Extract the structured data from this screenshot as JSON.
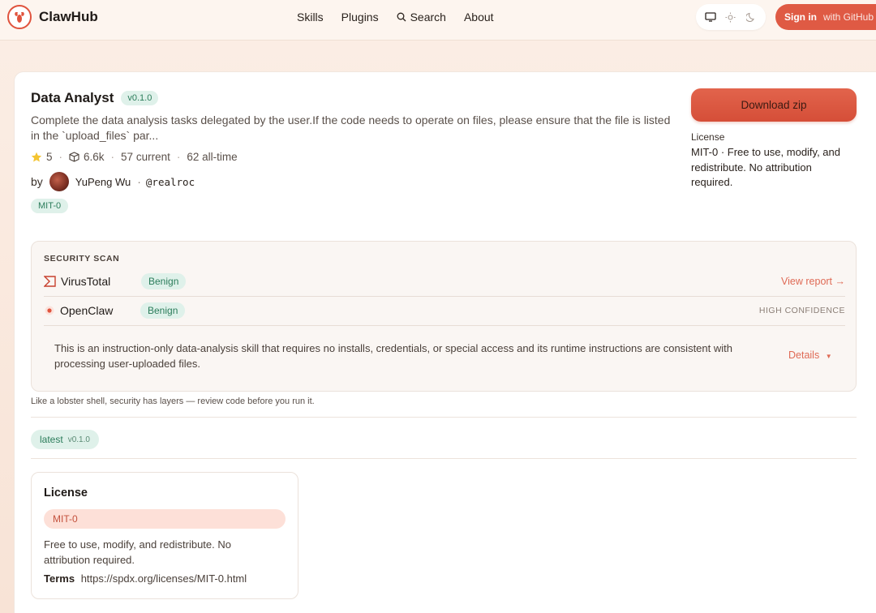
{
  "header": {
    "brand": "ClawHub",
    "nav": [
      "Skills",
      "Plugins",
      "Search",
      "About"
    ],
    "signin_label": "Sign in",
    "signin_suffix": "with GitHub"
  },
  "skill": {
    "title": "Data Analyst",
    "version": "v0.1.0",
    "description": "Complete the data analysis tasks delegated by the user.If the code needs to operate on files, please ensure that the file is listed in the `upload_files` par...",
    "stars": "5",
    "downloads": "6.6k",
    "current": "57 current",
    "all_time": "62 all-time",
    "by_label": "by",
    "author": "YuPeng Wu",
    "separator": "·",
    "handle": "@realroc",
    "license_pill": "MIT-0"
  },
  "sidebar": {
    "download_label": "Download zip",
    "license_label": "License",
    "license_text": "MIT-0 · Free to use, modify, and redistribute. No attribution required."
  },
  "security": {
    "heading": "SECURITY SCAN",
    "rows": [
      {
        "name": "VirusTotal",
        "status": "Benign",
        "action": "View report →"
      },
      {
        "name": "OpenClaw",
        "status": "Benign",
        "meta": "HIGH CONFIDENCE"
      }
    ],
    "summary": "This is an instruction-only data-analysis skill that requires no installs, credentials, or special access and its runtime instructions are consistent with processing user-uploaded files.",
    "details_label": "Details",
    "note": "Like a lobster shell, security has layers — review code before you run it."
  },
  "versions": {
    "latest_label": "latest",
    "latest_version": "v0.1.0"
  },
  "license_card": {
    "title": "License",
    "tag": "MIT-0",
    "description": "Free to use, modify, and redistribute. No attribution required.",
    "terms_label": "Terms",
    "terms_url": "https://spdx.org/licenses/MIT-0.html"
  },
  "colors": {
    "accent": "#df5a44",
    "benign_bg": "#dff1ea",
    "benign_text": "#2b7c5a"
  }
}
